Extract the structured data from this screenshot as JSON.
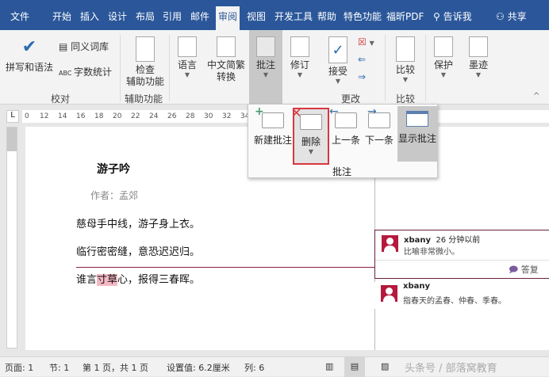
{
  "tabs": [
    "文件",
    "开始",
    "插入",
    "设计",
    "布局",
    "引用",
    "邮件",
    "审阅",
    "视图",
    "开发工具",
    "帮助",
    "特色功能",
    "福昕PDF"
  ],
  "tell_me": "告诉我",
  "share": "共享",
  "ribbon": {
    "spelling": "拼写和语法",
    "thesaurus": "同义词库",
    "word_count": "字数统计",
    "proofing_group": "校对",
    "check_access": [
      "检查",
      "辅助功能"
    ],
    "access_group": "辅助功能",
    "language": "语言",
    "chinese_convert": [
      "中文简繁",
      "转换"
    ],
    "comments": "批注",
    "track": "修订",
    "accept": "接受",
    "changes_group": "更改",
    "compare": "比较",
    "compare_group": "比较",
    "protect": "保护",
    "ink": "墨迹"
  },
  "popup": {
    "new": "新建批注",
    "delete": "删除",
    "prev": "上一条",
    "next": "下一条",
    "show": "显示批注",
    "group": "批注"
  },
  "ruler": [
    "0",
    "12",
    "14",
    "16",
    "18",
    "20",
    "22",
    "24",
    "26",
    "28",
    "30",
    "32",
    "34"
  ],
  "doc": {
    "title": "游子吟",
    "author": "作者：孟郊",
    "lines": [
      "慈母手中线，游子身上衣。",
      "临行密密缝，意恐迟迟归。"
    ],
    "line3_pre": "谁言",
    "line3_hl": "寸草",
    "line3_post": "心，报得三春晖。"
  },
  "comments": [
    {
      "author": "xbany",
      "time": "26 分钟以前",
      "text": "比喻非常微小。",
      "reply": "答复"
    },
    {
      "author": "xbany",
      "text": "指春天的孟春、仲春、季春。"
    }
  ],
  "status": {
    "page": "页面: 1",
    "section": "节: 1",
    "pages": "第 1 页，共 1 页",
    "setting": "设置值: 6.2厘米",
    "column": "列: 6",
    "watermark": "头条号 / 部落窝教育"
  },
  "colors": {
    "accent": "#2b579a",
    "highlight": "#f4b8c4",
    "comment": "#b5193e",
    "delete_outline": "#d9363e"
  }
}
